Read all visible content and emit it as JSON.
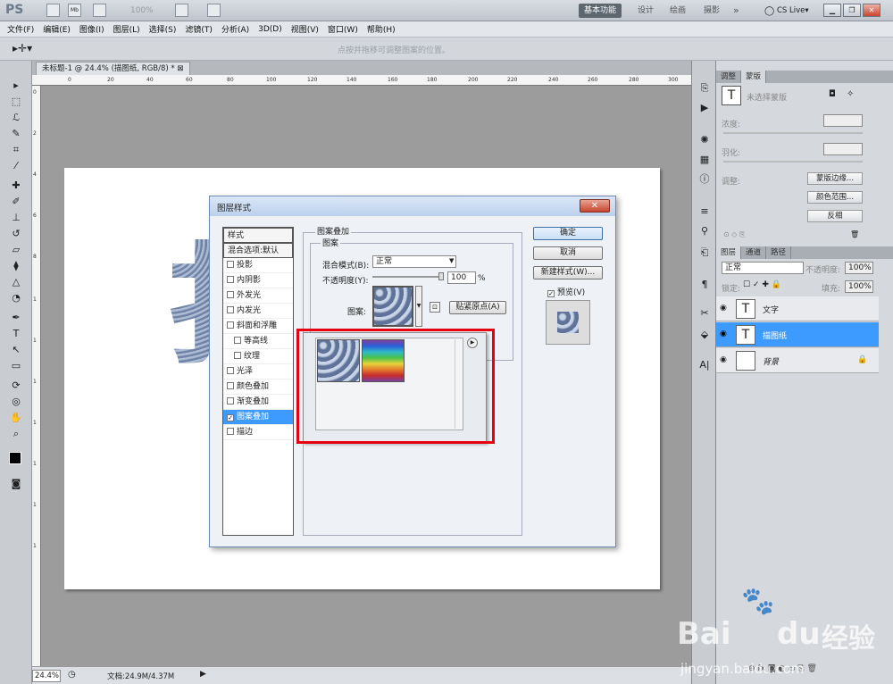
{
  "app": {
    "logo": "PS",
    "zoom_display": "100%",
    "workspaces": [
      "基本功能",
      "设计",
      "绘画",
      "摄影",
      "»"
    ],
    "cslive": "CS Live▾"
  },
  "menu": [
    "文件(F)",
    "编辑(E)",
    "图像(I)",
    "图层(L)",
    "选择(S)",
    "滤镜(T)",
    "分析(A)",
    "3D(D)",
    "视图(V)",
    "窗口(W)",
    "帮助(H)"
  ],
  "options": {
    "hint": "点按并拖移可调整图案的位置。"
  },
  "document": {
    "tab_title": "未标题-1 @ 24.4% (描图纸, RGB/8) * ⊠",
    "ruler_ticks": [
      "0",
      "20",
      "40",
      "60",
      "80",
      "100",
      "120",
      "140",
      "160",
      "180",
      "200",
      "220",
      "240",
      "260",
      "280",
      "300"
    ],
    "ruler_ticks_v": [
      "0",
      "2",
      "4",
      "6",
      "8",
      "1",
      "1",
      "1",
      "1",
      "1",
      "1",
      "1"
    ],
    "canvas_text": "扌"
  },
  "status": {
    "zoom": "24.4%",
    "doc": "文档:24.9M/4.37M"
  },
  "panels": {
    "masks": {
      "tabs": [
        "调整",
        "蒙版"
      ],
      "title": "未选择蒙版",
      "density_label": "浓度:",
      "feather_label": "羽化:",
      "refine_label": "调整:",
      "buttons": [
        "蒙版边缘...",
        "颜色范围...",
        "反相"
      ]
    },
    "layers": {
      "tabs": [
        "图层",
        "通道",
        "路径"
      ],
      "blend": "正常",
      "opacity_label": "不透明度:",
      "opacity": "100%",
      "lock_label": "锁定:",
      "fill_label": "填充:",
      "fill": "100%",
      "items": [
        {
          "name": "文字",
          "thumb": "T",
          "selected": false
        },
        {
          "name": "描图纸",
          "thumb": "T",
          "selected": true
        },
        {
          "name": "背景",
          "thumb": "",
          "selected": false
        }
      ]
    }
  },
  "dialog": {
    "title": "图层样式",
    "close": "✕",
    "styles_header": "样式",
    "blend_default": "混合选项:默认",
    "styles": [
      {
        "label": "投影",
        "checked": false,
        "indent": false
      },
      {
        "label": "内阴影",
        "checked": false,
        "indent": false
      },
      {
        "label": "外发光",
        "checked": false,
        "indent": false
      },
      {
        "label": "内发光",
        "checked": false,
        "indent": false
      },
      {
        "label": "斜面和浮雕",
        "checked": false,
        "indent": false
      },
      {
        "label": "等高线",
        "checked": false,
        "indent": true
      },
      {
        "label": "纹理",
        "checked": false,
        "indent": true
      },
      {
        "label": "光泽",
        "checked": false,
        "indent": false
      },
      {
        "label": "颜色叠加",
        "checked": false,
        "indent": false
      },
      {
        "label": "渐变叠加",
        "checked": false,
        "indent": false
      },
      {
        "label": "图案叠加",
        "checked": true,
        "indent": false,
        "selected": true
      },
      {
        "label": "描边",
        "checked": false,
        "indent": false
      }
    ],
    "group_title": "图案叠加",
    "subgroup_title": "图案",
    "blend_mode_label": "混合模式(B):",
    "blend_mode": "正常",
    "opacity_label": "不透明度(Y):",
    "opacity_value": "100",
    "opacity_unit": "%",
    "opacity_fraction": 1.0,
    "pattern_label": "图案:",
    "snap_button": "贴紧原点(A)",
    "buttons": {
      "ok": "确定",
      "cancel": "取消",
      "new_style": "新建样式(W)...",
      "preview": "预览(V)"
    },
    "preview_checked": true
  },
  "watermark": {
    "brand": "Bai",
    "brand2": "du",
    "brand3": "经验",
    "url": "jingyan.baidu.com"
  },
  "colors": {
    "highlight": "#e60012",
    "selection": "#3d9bff"
  }
}
